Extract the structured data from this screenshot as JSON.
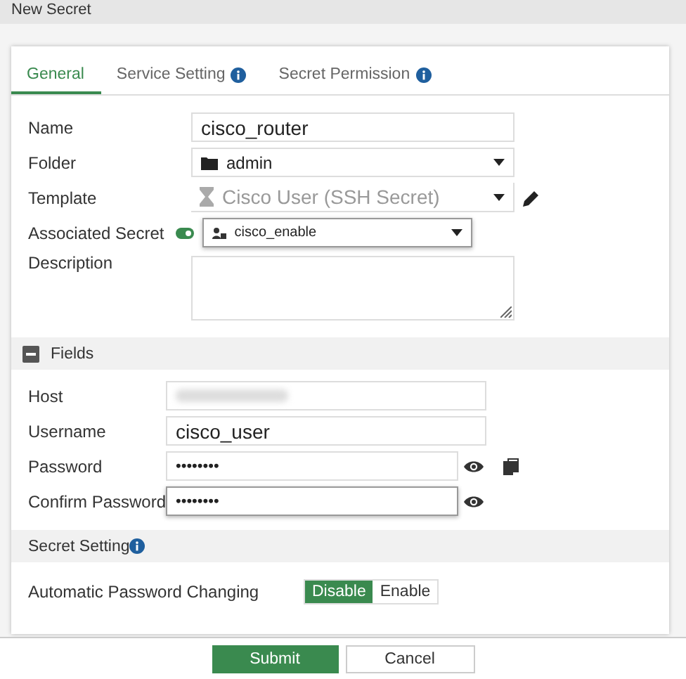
{
  "window": {
    "title": "New Secret"
  },
  "tabs": [
    {
      "label": "General",
      "selected": true,
      "info": false
    },
    {
      "label": "Service Setting",
      "selected": false,
      "info": true
    },
    {
      "label": "Secret Permission",
      "selected": false,
      "info": true
    }
  ],
  "general": [
    {
      "kind": "text",
      "label": "Name",
      "value": "cisco_router"
    },
    {
      "kind": "select",
      "label": "Folder",
      "value": "admin"
    },
    {
      "kind": "template",
      "label": "Template",
      "value": "Cisco User (SSH Secret)",
      "disabled": true
    },
    {
      "kind": "associated",
      "label": "Associated Secret",
      "on": true,
      "value": "cisco_enable"
    },
    {
      "kind": "textarea",
      "label": "Description"
    }
  ],
  "fields_section": {
    "title": "Fields",
    "expanded": true
  },
  "fields": [
    {
      "kind": "redacted",
      "label": "Host"
    },
    {
      "kind": "text",
      "label": "Username",
      "value": "cisco_user"
    },
    {
      "kind": "password",
      "label": "Password",
      "value": "••••••••",
      "copy": true,
      "focused": false
    },
    {
      "kind": "password",
      "label": "Confirm Password",
      "value": "••••••••",
      "copy": false,
      "focused": true
    }
  ],
  "secret_setting": {
    "title": "Secret Setting"
  },
  "toggles": [
    {
      "label": "Automatic Password Changing",
      "options": [
        {
          "label": "Disable",
          "selected": true
        },
        {
          "label": "Enable",
          "selected": false
        }
      ]
    }
  ],
  "buttons": [
    {
      "label": "Submit",
      "primary": true
    },
    {
      "label": "Cancel",
      "primary": false
    }
  ]
}
